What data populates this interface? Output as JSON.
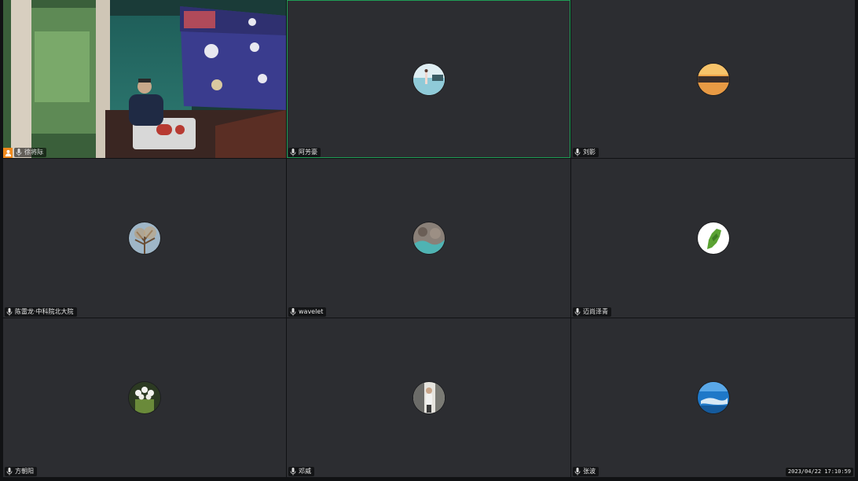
{
  "participants": [
    {
      "name": "徐将际",
      "host": true,
      "avatar": "video"
    },
    {
      "name": "阿芳豪",
      "active": true,
      "avatar": "beach-poolside"
    },
    {
      "name": "刘影",
      "avatar": "sunset-sea"
    },
    {
      "name": "陈雷龙·中科院北大院",
      "avatar": "bare-tree"
    },
    {
      "name": "wavelet",
      "avatar": "rocky-shore"
    },
    {
      "name": "迈尚泽青",
      "avatar": "green-map"
    },
    {
      "name": "方朝阳",
      "avatar": "white-flowers"
    },
    {
      "name": "邓威",
      "avatar": "hiker"
    },
    {
      "name": "张波",
      "avatar": "ocean-blue"
    }
  ],
  "timestamp": "2023/04/22 17:10:59",
  "colors": {
    "tile_bg": "#2c2d31",
    "active_border": "#1f9d55",
    "host_badge": "#f08a1c"
  },
  "icons": {
    "mic": "mic-icon",
    "host": "host-person-icon"
  }
}
